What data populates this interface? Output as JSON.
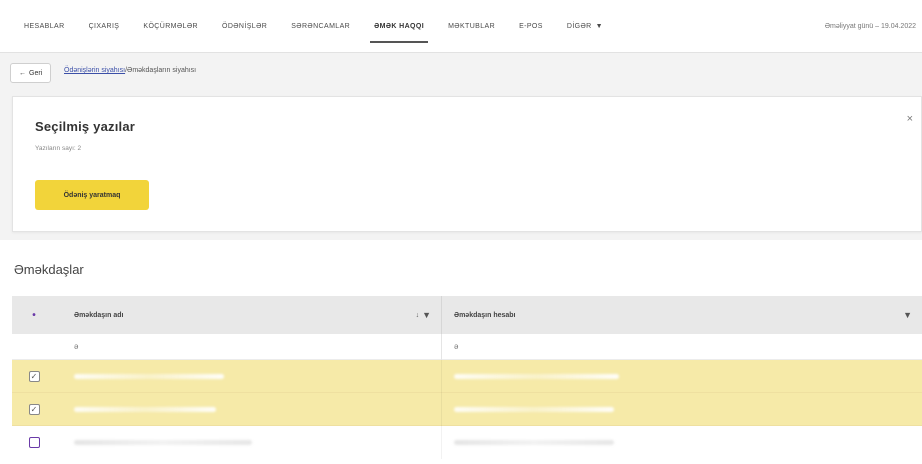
{
  "nav": {
    "items": [
      {
        "label": "HESABLAR"
      },
      {
        "label": "ÇIXARIŞ"
      },
      {
        "label": "KÖÇÜRMƏLƏR"
      },
      {
        "label": "ÖDƏNİŞLƏR"
      },
      {
        "label": "SƏRƏNCAMLAR"
      },
      {
        "label": "ƏMƏK HAQQI"
      },
      {
        "label": "MƏKTUBLAR"
      },
      {
        "label": "E-POS"
      },
      {
        "label": "DİGƏR"
      }
    ],
    "active_index": 5,
    "right_text": "Əməliyyat günü – 19.04.2022"
  },
  "breadcrumb": {
    "back_label": "Geri",
    "link_label": "Ödənişlərin siyahısı",
    "current_label": "Əməkdaşların siyahısı"
  },
  "panel": {
    "title": "Seçilmiş yazılar",
    "subtitle": "Yazıların sayı: 2",
    "button_label": "Ödəniş yaratmaq"
  },
  "section_title": "Əməkdaşlar",
  "table": {
    "columns": [
      {
        "label": "Əməkdaşın adı"
      },
      {
        "label": "Əməkdaşın hesabı"
      }
    ],
    "filter_placeholder": "ə",
    "sort_indicator": "↓"
  },
  "rows_state": [
    "selected",
    "selected",
    "unselected"
  ],
  "colors": {
    "accent_yellow": "#f2d43a",
    "selected_row": "#f6eaa8",
    "purple": "#6a3aa8"
  }
}
